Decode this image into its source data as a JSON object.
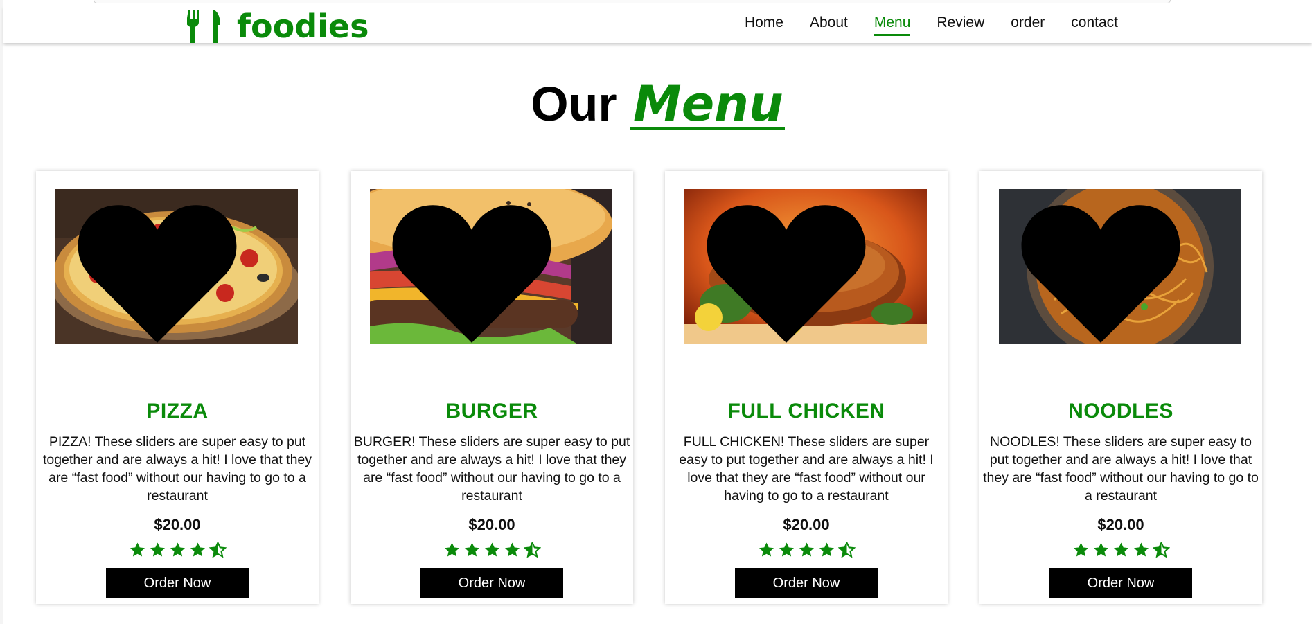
{
  "brand": {
    "name": "foodies",
    "color": "#0a8a0a",
    "icon": "fork-knife-icon"
  },
  "nav": [
    {
      "label": "Home",
      "active": false
    },
    {
      "label": "About",
      "active": false
    },
    {
      "label": "Menu",
      "active": true
    },
    {
      "label": "Review",
      "active": false
    },
    {
      "label": "order",
      "active": false
    },
    {
      "label": "contact",
      "active": false
    }
  ],
  "heading": {
    "prefix": "Our",
    "highlight": "Menu"
  },
  "cards": [
    {
      "image": "pizza-photo",
      "title": "PIZZA",
      "desc": "PIZZA! These sliders are super easy to put together and are always a hit! I love that they are “fast food” without our having to go to a restaurant",
      "price": "$20.00",
      "rating": 4.5,
      "button": "Order Now"
    },
    {
      "image": "burger-photo",
      "title": "BURGER",
      "desc": "BURGER! These sliders are super easy to put together and are always a hit! I love that they are “fast food” without our having to go to a restaurant",
      "price": "$20.00",
      "rating": 4.5,
      "button": "Order Now"
    },
    {
      "image": "roast-chicken-photo",
      "title": "FULL CHICKEN",
      "desc": "FULL CHICKEN! These sliders are super easy to put together and are always a hit! I love that they are “fast food” without our having to go to a restaurant",
      "price": "$20.00",
      "rating": 4.5,
      "button": "Order Now"
    },
    {
      "image": "noodles-photo",
      "title": "NOODLES",
      "desc": "NOODLES! These sliders are super easy to put together and are always a hit! I love that they are “fast food” without our having to go to a restaurant",
      "price": "$20.00",
      "rating": 4.5,
      "button": "Order Now"
    }
  ]
}
